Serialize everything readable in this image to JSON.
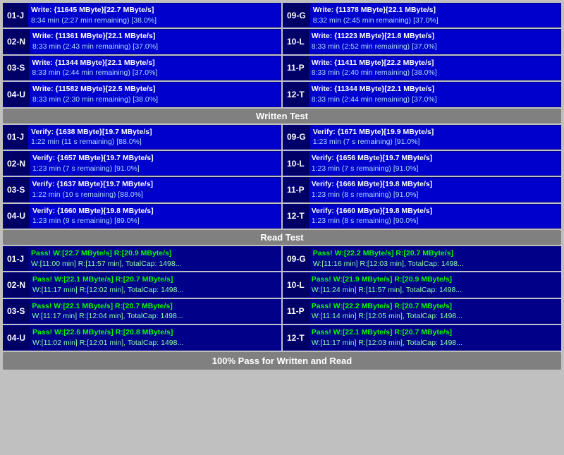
{
  "sections": {
    "write": {
      "label": "Written Test",
      "drives_left": [
        {
          "id": "01-J",
          "line1": "Write: {11645 MByte}[22.7 MByte/s]",
          "line2": "8:34 min (2:27 min remaining)  [38.0%]"
        },
        {
          "id": "02-N",
          "line1": "Write: {11361 MByte}[22.1 MByte/s]",
          "line2": "8:33 min (2:43 min remaining)  [37.0%]"
        },
        {
          "id": "03-S",
          "line1": "Write: {11344 MByte}[22.1 MByte/s]",
          "line2": "8:33 min (2:44 min remaining)  [37.0%]"
        },
        {
          "id": "04-U",
          "line1": "Write: {11582 MByte}[22.5 MByte/s]",
          "line2": "8:33 min (2:30 min remaining)  [38.0%]"
        }
      ],
      "drives_right": [
        {
          "id": "09-G",
          "line1": "Write: {11378 MByte}[22.1 MByte/s]",
          "line2": "8:32 min (2:45 min remaining)  [37.0%]"
        },
        {
          "id": "10-L",
          "line1": "Write: {11223 MByte}[21.8 MByte/s]",
          "line2": "8:33 min (2:52 min remaining)  [37.0%]"
        },
        {
          "id": "11-P",
          "line1": "Write: {11411 MByte}[22.2 MByte/s]",
          "line2": "8:33 min (2:40 min remaining)  [38.0%]"
        },
        {
          "id": "12-T",
          "line1": "Write: {11344 MByte}[22.1 MByte/s]",
          "line2": "8:33 min (2:44 min remaining)  [37.0%]"
        }
      ]
    },
    "verify": {
      "label": "Written Test",
      "drives_left": [
        {
          "id": "01-J",
          "line1": "Verify: {1638 MByte}[19.7 MByte/s]",
          "line2": "1:22 min (11 s remaining)   [88.0%]"
        },
        {
          "id": "02-N",
          "line1": "Verify: {1657 MByte}[19.7 MByte/s]",
          "line2": "1:23 min (7 s remaining)   [91.0%]"
        },
        {
          "id": "03-S",
          "line1": "Verify: {1637 MByte}[19.7 MByte/s]",
          "line2": "1:22 min (10 s remaining)   [88.0%]"
        },
        {
          "id": "04-U",
          "line1": "Verify: {1660 MByte}[19.8 MByte/s]",
          "line2": "1:23 min (9 s remaining)   [89.0%]"
        }
      ],
      "drives_right": [
        {
          "id": "09-G",
          "line1": "Verify: {1671 MByte}[19.9 MByte/s]",
          "line2": "1:23 min (7 s remaining)   [91.0%]"
        },
        {
          "id": "10-L",
          "line1": "Verify: {1656 MByte}[19.7 MByte/s]",
          "line2": "1:23 min (7 s remaining)   [91.0%]"
        },
        {
          "id": "11-P",
          "line1": "Verify: {1666 MByte}[19.8 MByte/s]",
          "line2": "1:23 min (8 s remaining)   [91.0%]"
        },
        {
          "id": "12-T",
          "line1": "Verify: {1660 MByte}[19.8 MByte/s]",
          "line2": "1:23 min (8 s remaining)   [90.0%]"
        }
      ]
    },
    "read": {
      "label": "Read Test",
      "drives_left": [
        {
          "id": "01-J",
          "line1": "Pass! W:[22.7 MByte/s] R:[20.9 MByte/s]",
          "line2": "W:[11:00 min] R:[11:57 min], TotalCap: 1498..."
        },
        {
          "id": "02-N",
          "line1": "Pass! W:[22.1 MByte/s] R:[20.7 MByte/s]",
          "line2": "W:[11:17 min] R:[12:02 min], TotalCap: 1498..."
        },
        {
          "id": "03-S",
          "line1": "Pass! W:[22.1 MByte/s] R:[20.7 MByte/s]",
          "line2": "W:[11:17 min] R:[12:04 min], TotalCap: 1498..."
        },
        {
          "id": "04-U",
          "line1": "Pass! W:[22.6 MByte/s] R:[20.8 MByte/s]",
          "line2": "W:[11:02 min] R:[12:01 min], TotalCap: 1498..."
        }
      ],
      "drives_right": [
        {
          "id": "09-G",
          "line1": "Pass! W:[22.2 MByte/s] R:[20.7 MByte/s]",
          "line2": "W:[11:16 min] R:[12:03 min], TotalCap: 1498..."
        },
        {
          "id": "10-L",
          "line1": "Pass! W:[21.9 MByte/s] R:[20.9 MByte/s]",
          "line2": "W:[11:24 min] R:[11:57 min], TotalCap: 1498..."
        },
        {
          "id": "11-P",
          "line1": "Pass! W:[22.2 MByte/s] R:[20.7 MByte/s]",
          "line2": "W:[11:14 min] R:[12:05 min], TotalCap: 1498..."
        },
        {
          "id": "12-T",
          "line1": "Pass! W:[22.1 MByte/s] R:[20.7 MByte/s]",
          "line2": "W:[11:17 min] R:[12:03 min], TotalCap: 1498..."
        }
      ]
    }
  },
  "footer": "100% Pass for Written and Read"
}
